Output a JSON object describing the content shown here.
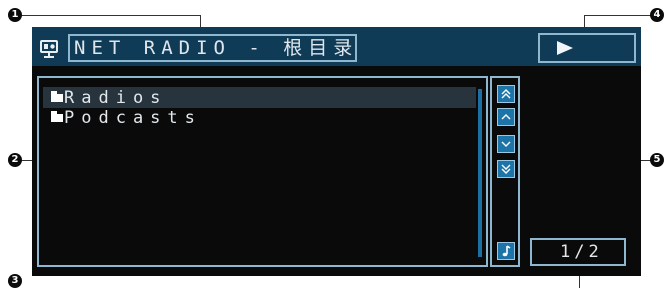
{
  "header": {
    "source_icon": "net-radio-icon",
    "title": "NET RADIO - 根目录",
    "playback_icon": "play-icon"
  },
  "list": {
    "items": [
      {
        "label": "Radios",
        "icon": "folder-icon",
        "selected": true
      },
      {
        "label": "Podcasts",
        "icon": "folder-icon",
        "selected": false
      }
    ]
  },
  "controls": {
    "buttons": [
      "page-up-icon",
      "cursor-up-icon",
      "cursor-down-icon",
      "page-down-icon"
    ],
    "music_icon": "music-note-icon"
  },
  "page": {
    "indicator": "1/2"
  },
  "callouts": [
    "1",
    "2",
    "3",
    "4",
    "5"
  ],
  "colors": {
    "header_band": "#0f3b57",
    "frame": "#8fb7cf",
    "button": "#1d74a8",
    "screen": "#0a0a0a",
    "selection": "#27333d"
  }
}
